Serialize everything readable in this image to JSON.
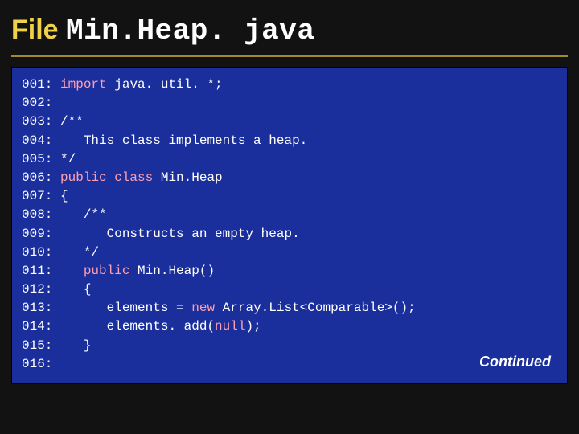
{
  "title": {
    "file_word": "File",
    "file_name": "Min.Heap. java"
  },
  "code": {
    "lines": [
      {
        "num": "001:",
        "segs": [
          {
            "c": "kw",
            "t": "import "
          },
          {
            "c": "plain",
            "t": "java. util. *;"
          }
        ]
      },
      {
        "num": "002:",
        "segs": []
      },
      {
        "num": "003:",
        "segs": [
          {
            "c": "plain",
            "t": "/**"
          }
        ]
      },
      {
        "num": "004:",
        "segs": [
          {
            "c": "plain",
            "t": "   This class implements a heap."
          }
        ]
      },
      {
        "num": "005:",
        "segs": [
          {
            "c": "plain",
            "t": "*/"
          }
        ]
      },
      {
        "num": "006:",
        "segs": [
          {
            "c": "kw",
            "t": "public class "
          },
          {
            "c": "plain",
            "t": "Min.Heap"
          }
        ]
      },
      {
        "num": "007:",
        "segs": [
          {
            "c": "plain",
            "t": "{"
          }
        ]
      },
      {
        "num": "008:",
        "segs": [
          {
            "c": "plain",
            "t": "   /**"
          }
        ]
      },
      {
        "num": "009:",
        "segs": [
          {
            "c": "plain",
            "t": "      Constructs an empty heap."
          }
        ]
      },
      {
        "num": "010:",
        "segs": [
          {
            "c": "plain",
            "t": "   */"
          }
        ]
      },
      {
        "num": "011:",
        "segs": [
          {
            "c": "plain",
            "t": "   "
          },
          {
            "c": "kw",
            "t": "public "
          },
          {
            "c": "plain",
            "t": "Min.Heap()"
          }
        ]
      },
      {
        "num": "012:",
        "segs": [
          {
            "c": "plain",
            "t": "   {"
          }
        ]
      },
      {
        "num": "013:",
        "segs": [
          {
            "c": "plain",
            "t": "      elements = "
          },
          {
            "c": "kw",
            "t": "new "
          },
          {
            "c": "plain",
            "t": "Array.List<Comparable>();"
          }
        ]
      },
      {
        "num": "014:",
        "segs": [
          {
            "c": "plain",
            "t": "      elements. add("
          },
          {
            "c": "kw",
            "t": "null"
          },
          {
            "c": "plain",
            "t": ");"
          }
        ]
      },
      {
        "num": "015:",
        "segs": [
          {
            "c": "plain",
            "t": "   }"
          }
        ]
      },
      {
        "num": "016:",
        "segs": []
      }
    ]
  },
  "continued_label": "Continued"
}
